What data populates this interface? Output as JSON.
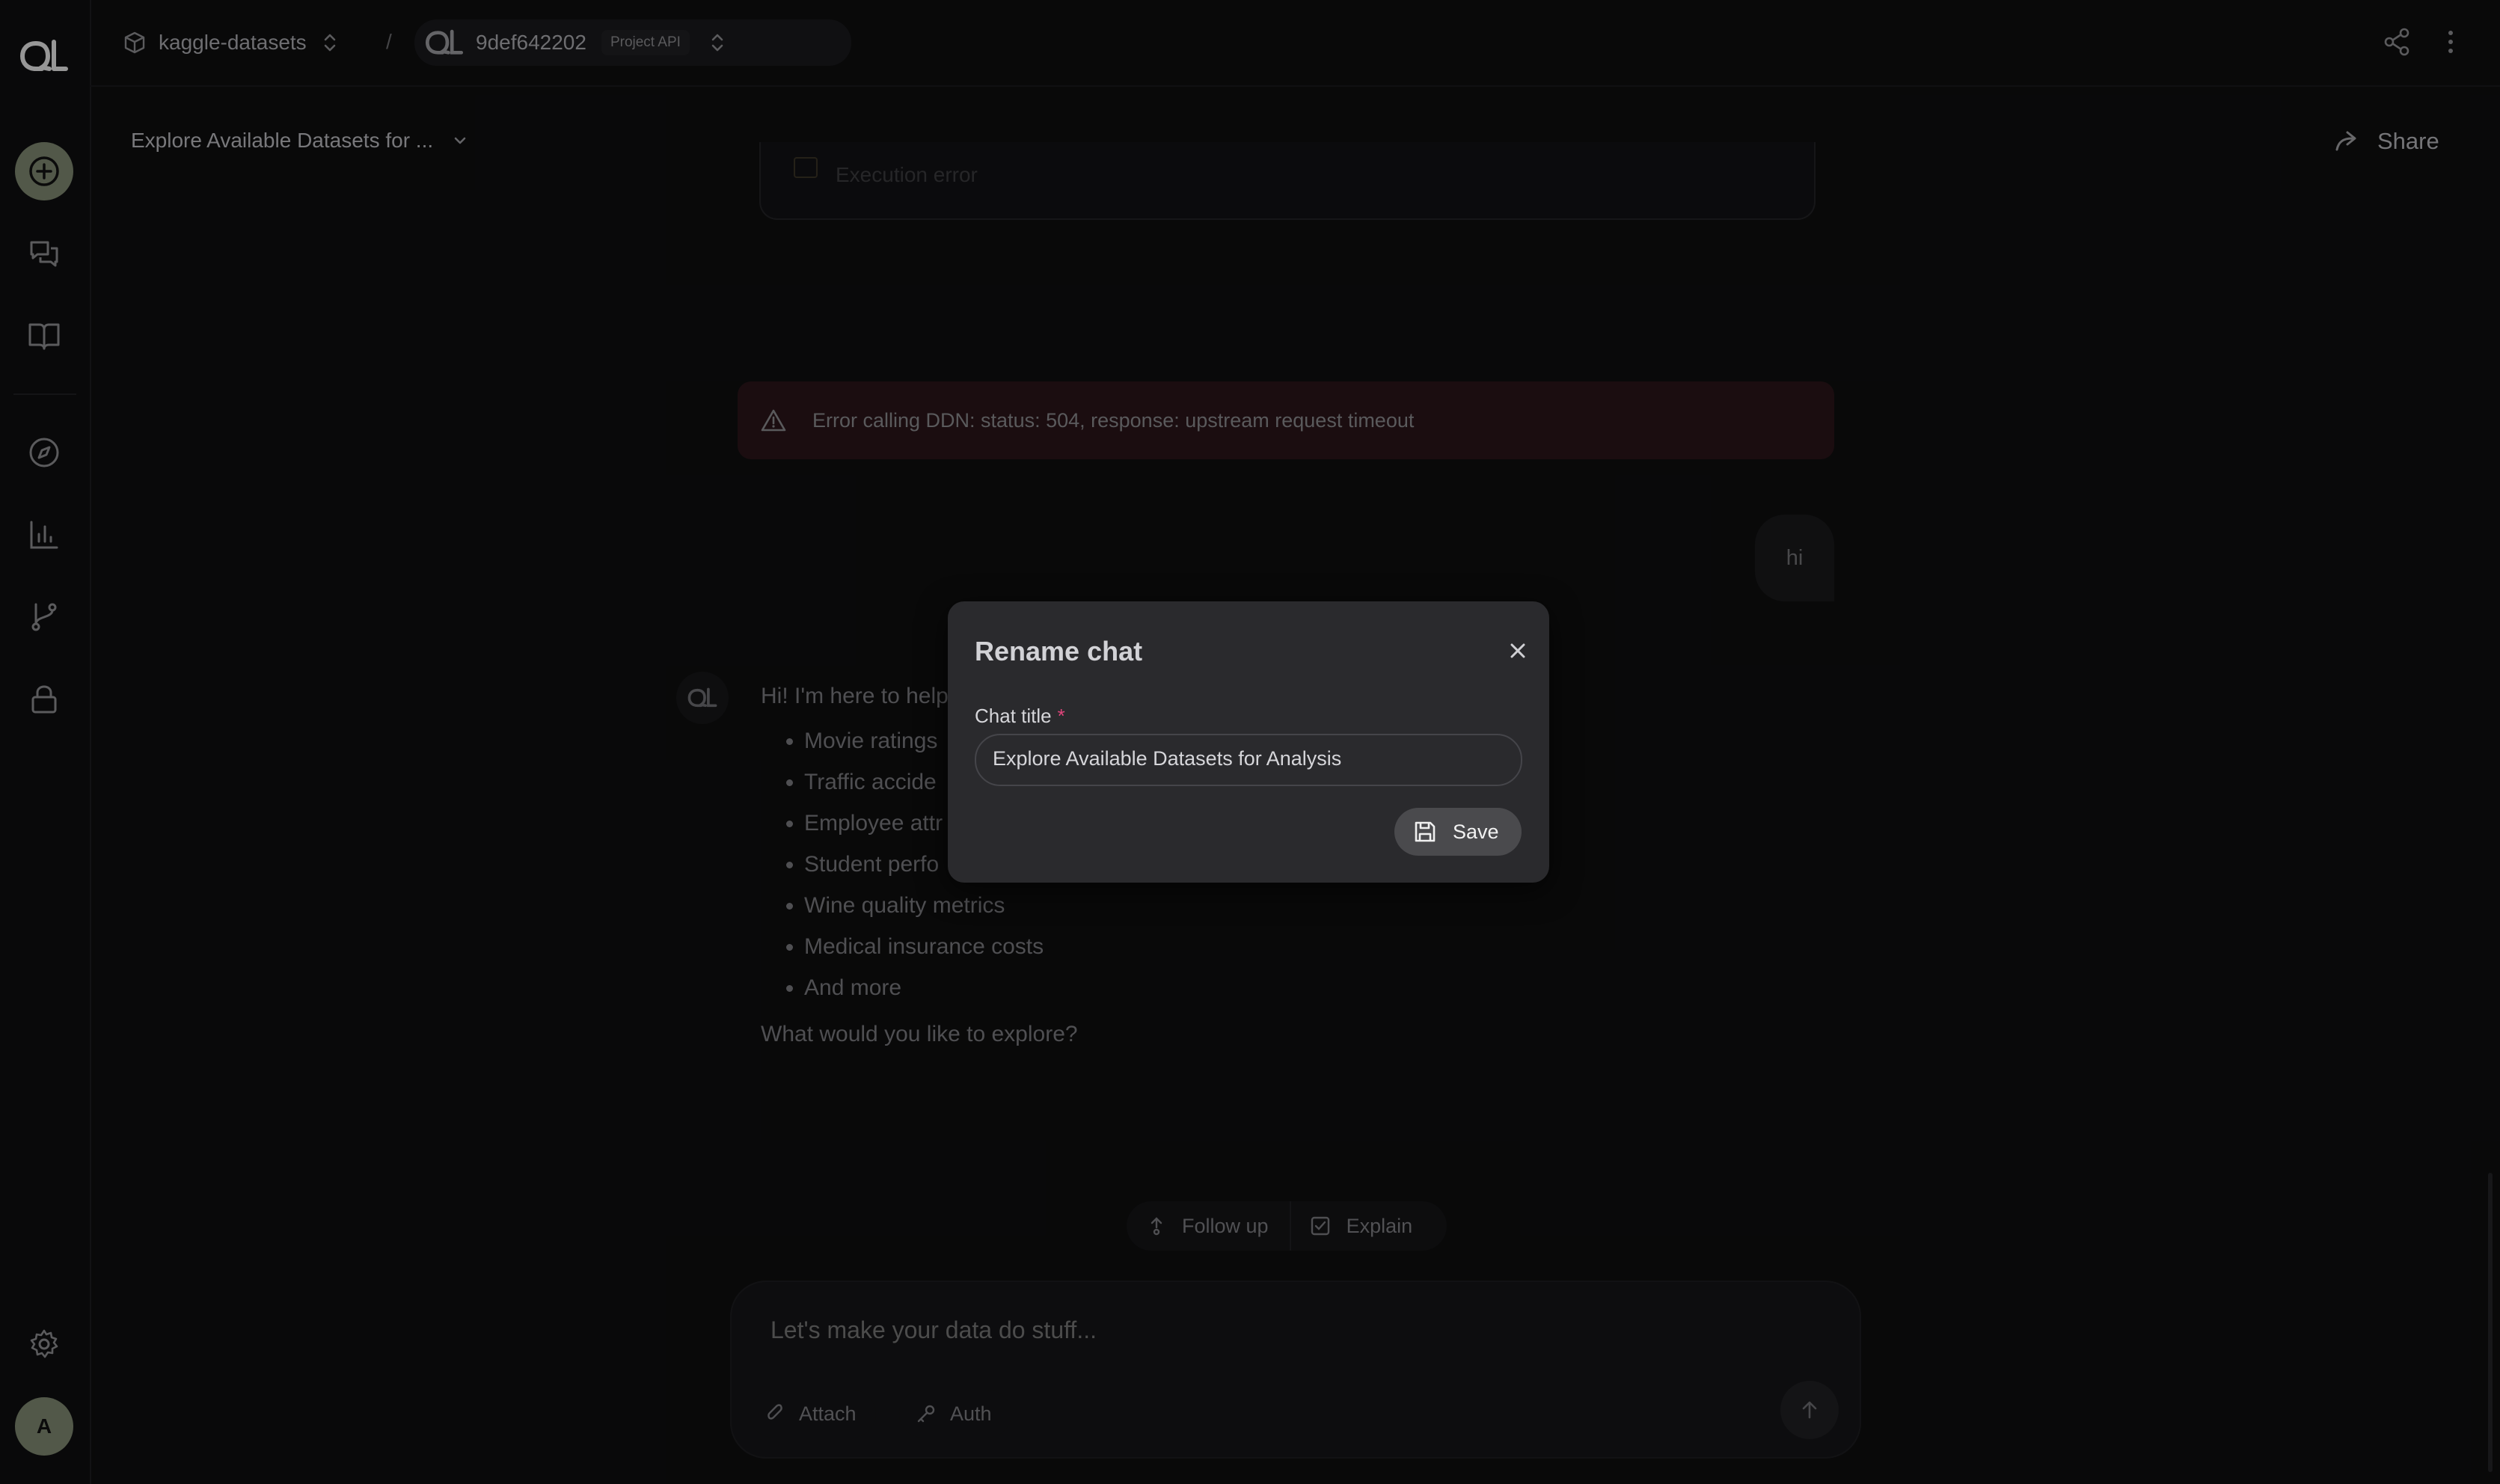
{
  "breadcrumb": {
    "project": "kaggle-datasets",
    "separator": "/",
    "build_id": "9def642202",
    "build_badge": "Project API"
  },
  "header": {
    "chat_title": "Explore Available Datasets for ...",
    "share_label": "Share"
  },
  "chat": {
    "error_text": "Error calling DDN: status: 504, response: upstream request timeout",
    "user_message": "hi",
    "assistant_intro": "Hi! I'm here to help",
    "assistant_list": [
      "Movie ratings",
      "Traffic accide",
      "Employee attr",
      "Student perfo",
      "Wine quality metrics",
      "Medical insurance costs",
      "And more"
    ],
    "assistant_question": "What would you like to explore?",
    "prev_card_text": "Execution error"
  },
  "actions": {
    "follow_up": "Follow up",
    "explain": "Explain"
  },
  "composer": {
    "placeholder": "Let's make your data do stuff...",
    "attach": "Attach",
    "auth": "Auth"
  },
  "sidebar": {
    "avatar_letter": "A"
  },
  "modal": {
    "title": "Rename chat",
    "field_label": "Chat title",
    "required_mark": "*",
    "field_value": "Explore Available Datasets for Analysis",
    "save_label": "Save"
  },
  "colors": {
    "error_bg": "#2a1519",
    "accent_new": "#9aa58c",
    "required": "#e0457b"
  }
}
